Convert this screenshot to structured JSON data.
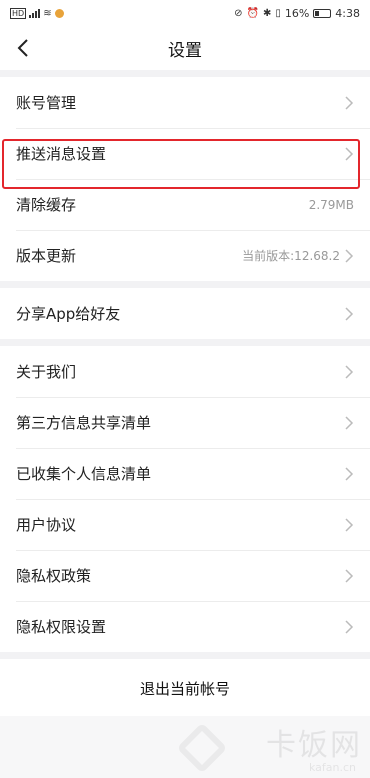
{
  "status_bar": {
    "carrier": "HD",
    "battery_percent": "16%",
    "time": "4:38",
    "icons": [
      "signal-icon",
      "wifi-icon",
      "weibo-icon",
      "nfc-icon",
      "alarm-icon",
      "bluetooth-icon",
      "vibrate-icon",
      "battery-icon"
    ]
  },
  "header": {
    "back_icon": "chevron-left-icon",
    "title": "设置"
  },
  "groups": [
    {
      "items": [
        {
          "label": "账号管理",
          "value": ""
        },
        {
          "label": "推送消息设置",
          "value": ""
        },
        {
          "label": "清除缓存",
          "value": "2.79MB"
        },
        {
          "label": "版本更新",
          "value": "当前版本:12.68.2"
        }
      ]
    },
    {
      "items": [
        {
          "label": "分享App给好友",
          "value": ""
        }
      ]
    },
    {
      "items": [
        {
          "label": "关于我们",
          "value": ""
        },
        {
          "label": "第三方信息共享清单",
          "value": ""
        },
        {
          "label": "已收集个人信息清单",
          "value": ""
        },
        {
          "label": "用户协议",
          "value": ""
        },
        {
          "label": "隐私权政策",
          "value": ""
        },
        {
          "label": "隐私权限设置",
          "value": ""
        }
      ]
    }
  ],
  "logout_label": "退出当前帐号",
  "highlight_color": "#e3262c",
  "watermark": {
    "text": "卡饭网",
    "sub": "kafan.cn"
  }
}
